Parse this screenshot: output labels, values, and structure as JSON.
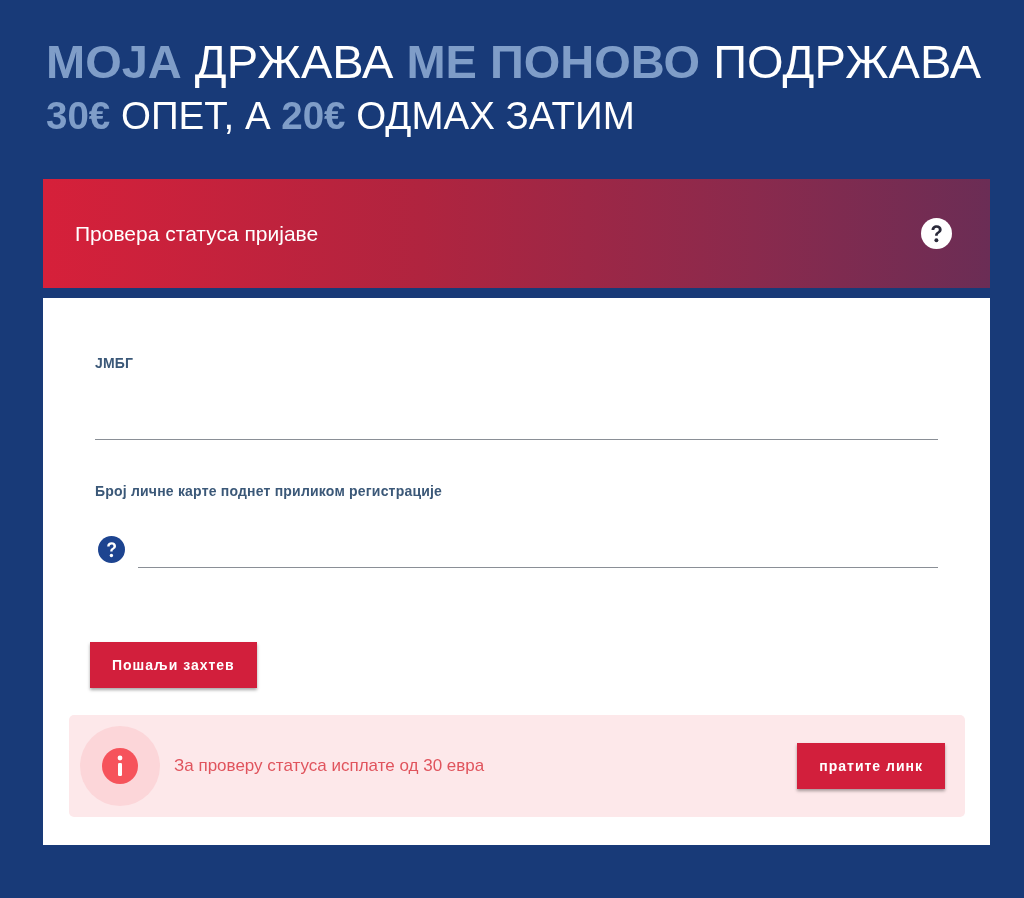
{
  "headline": {
    "line_1": "**МОЈА** ДРЖАВА **МЕ ПОНОВО** ПОДРЖАВА",
    "line_2": "**30€** ОПЕТ, А **20€** ОДМАХ ЗАТИМ"
  },
  "panel": {
    "title": "Провера статуса пријаве"
  },
  "form": {
    "fields": [
      {
        "label": "ЈМБГ",
        "help_icon": false
      },
      {
        "label": "Број личне карте поднет приликом регистрације",
        "help_icon": true
      }
    ],
    "submit_button": "Пошаљи захтев"
  },
  "notice": {
    "text": "За проверу статуса исплате од 30 евра",
    "button": "пратите линк"
  }
}
